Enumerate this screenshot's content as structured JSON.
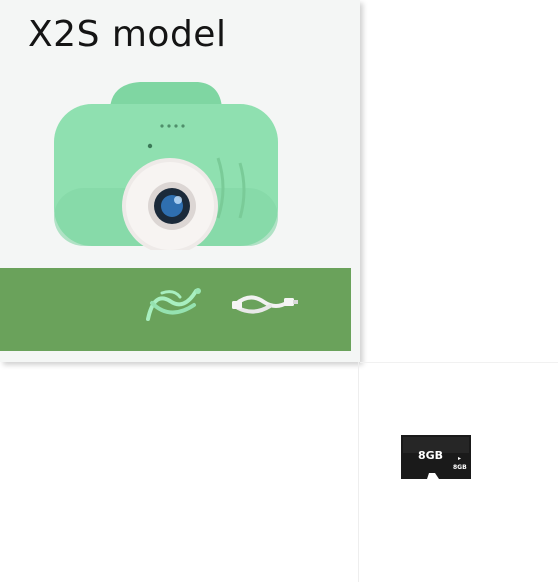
{
  "product_tile": {
    "title": "X2S model",
    "camera_color": "#8fe0b0",
    "accent_band_color": "#6aa25b",
    "items": [
      "camera-icon",
      "lanyard-strap-icon",
      "usb-cable-icon"
    ]
  },
  "memory_card": {
    "capacity_label": "8GB",
    "small_label": "8GB",
    "icon": "micro-sd-card-icon"
  }
}
